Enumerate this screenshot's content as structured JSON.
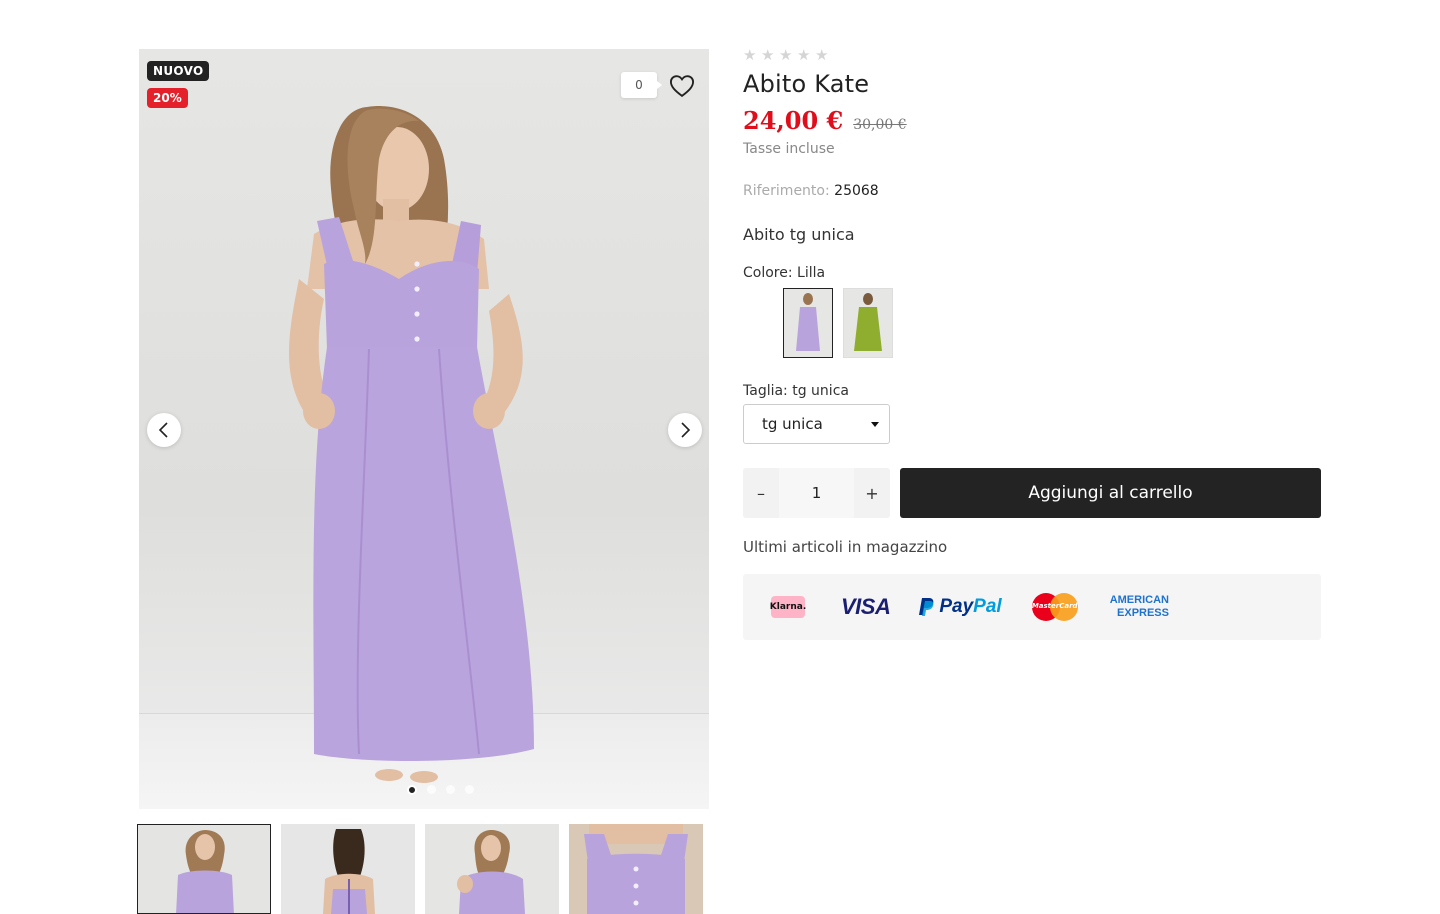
{
  "gallery": {
    "badges": {
      "new": "NUOVO",
      "discount": "20%"
    },
    "wishlist_count": "0",
    "slides": 4,
    "active_slide": 1,
    "thumbnails": [
      "front-full",
      "back-laces",
      "front-adjusting",
      "bodice-detail"
    ]
  },
  "product": {
    "rating_stars": 5,
    "rating_value": 0,
    "title": "Abito Kate",
    "price": "24,00 €",
    "old_price": "30,00 €",
    "tax_note": "Tasse incluse",
    "reference_label": "Riferimento:",
    "reference_value": "25068",
    "short_description": "Abito tg unica",
    "color_label": "Colore: Lilla",
    "color_swatches": [
      {
        "name": "Lilla",
        "color": "#b9a3dc",
        "selected": true
      },
      {
        "name": "Verde",
        "color": "#8fae2f",
        "selected": false
      }
    ],
    "size_label": "Taglia: tg unica",
    "size_selected": "tg unica",
    "quantity": "1",
    "qty_minus": "–",
    "qty_plus": "+",
    "add_to_cart": "Aggiungi al carrello",
    "stock_note": "Ultimi articoli in magazzino"
  },
  "payments": {
    "klarna": "Klarna.",
    "visa": "VISA",
    "paypal_a": "Pay",
    "paypal_b": "Pal",
    "mastercard": "MasterCard",
    "amex_line1": "AMERICAN",
    "amex_line2": "EXPRESS"
  },
  "colors": {
    "dress": "#b9a3dc",
    "price": "#e00d1b",
    "button": "#232323"
  }
}
